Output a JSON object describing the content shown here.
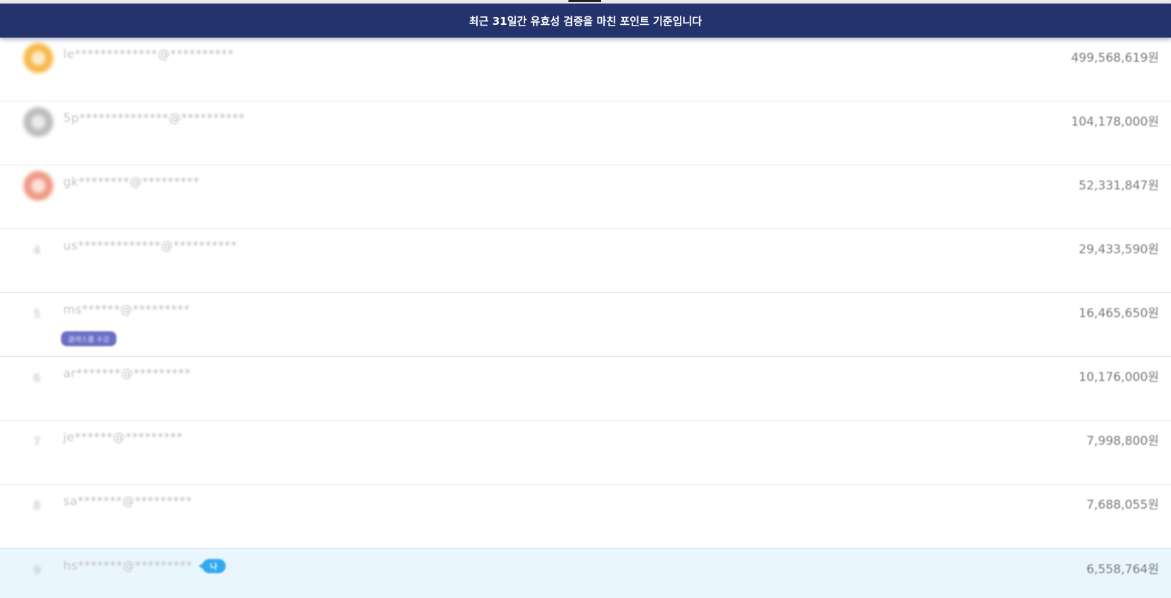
{
  "banner": {
    "text": "최근 31일간 유효성 검증을 마친 포인트 기준입니다"
  },
  "ranking": [
    {
      "rank": "1",
      "email": "le*************@**********",
      "amount": "499,568,619원",
      "medal_color": "#f6b94a"
    },
    {
      "rank": "2",
      "email": "5p**************@**********",
      "amount": "104,178,000원",
      "medal_color": "#bcbcbc"
    },
    {
      "rank": "3",
      "email": "gk********@*********",
      "amount": "52,331,847원",
      "medal_color": "#ef9a84"
    },
    {
      "rank": "4",
      "email": "us*************@**********",
      "amount": "29,433,590원"
    },
    {
      "rank": "5",
      "email": "ms******@*********",
      "amount": "16,465,650원",
      "tag": "클래스를 수강"
    },
    {
      "rank": "6",
      "email": "ar*******@*********",
      "amount": "10,176,000원"
    },
    {
      "rank": "7",
      "email": "je******@*********",
      "amount": "7,998,800원"
    },
    {
      "rank": "8",
      "email": "sa*******@*********",
      "amount": "7,688,055원"
    },
    {
      "rank": "9",
      "email": "hs*******@*********",
      "amount": "6,558,764원",
      "me_badge": "나"
    }
  ]
}
